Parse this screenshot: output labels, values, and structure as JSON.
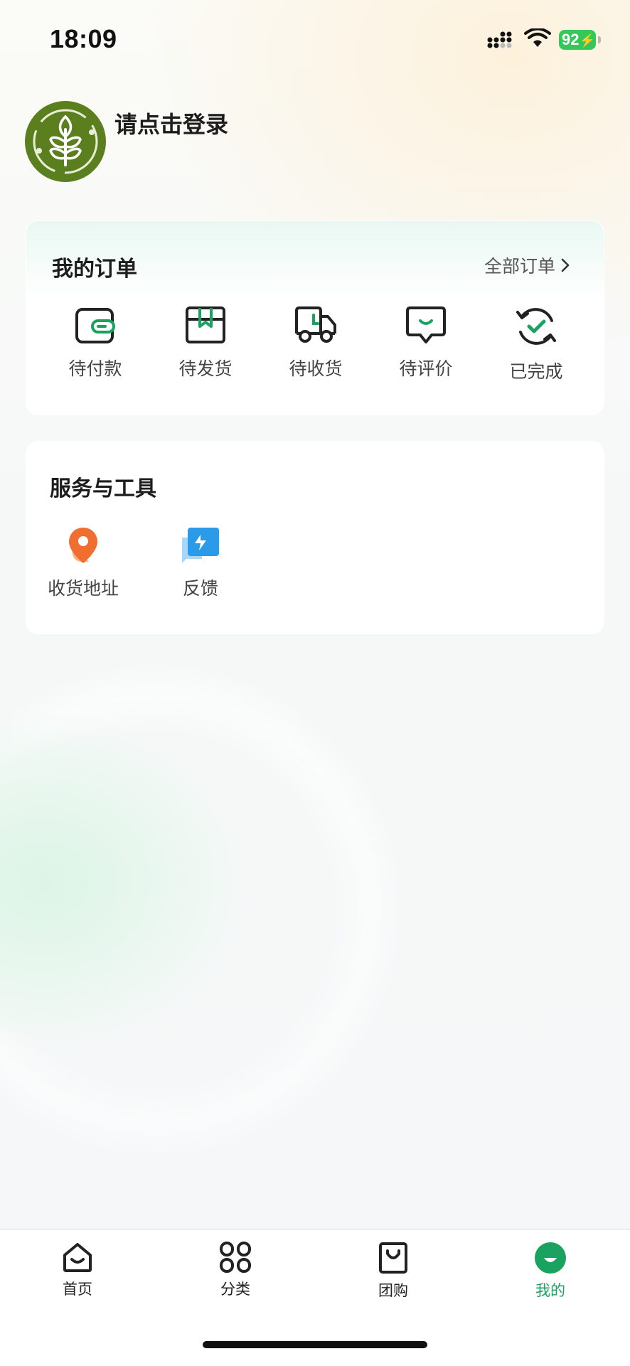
{
  "status_bar": {
    "time": "18:09",
    "battery": "92",
    "icons": [
      "signal-icon",
      "wifi-icon",
      "battery-charging-icon"
    ]
  },
  "profile": {
    "login_prompt": "请点击登录",
    "avatar_icon": "wheat-logo-icon"
  },
  "orders": {
    "title": "我的订单",
    "all_label": "全部订单",
    "items": [
      {
        "label": "待付款",
        "icon": "wallet-icon"
      },
      {
        "label": "待发货",
        "icon": "package-icon"
      },
      {
        "label": "待收货",
        "icon": "truck-icon"
      },
      {
        "label": "待评价",
        "icon": "review-icon"
      },
      {
        "label": "已完成",
        "icon": "completed-icon"
      }
    ]
  },
  "tools": {
    "title": "服务与工具",
    "items": [
      {
        "label": "收货地址",
        "icon": "location-pin-icon"
      },
      {
        "label": "反馈",
        "icon": "feedback-icon"
      }
    ]
  },
  "tabbar": {
    "items": [
      {
        "label": "首页",
        "icon": "home-icon"
      },
      {
        "label": "分类",
        "icon": "category-icon"
      },
      {
        "label": "团购",
        "icon": "group-buy-bag-icon"
      },
      {
        "label": "我的",
        "icon": "profile-smile-icon",
        "active": true
      }
    ]
  },
  "colors": {
    "accent": "#1aa260",
    "active_tab": "#1aa260",
    "avatar_bg": "#5b7f1e",
    "battery": "#34c759",
    "text_primary": "#1d1d1d",
    "text_secondary": "#444444"
  }
}
